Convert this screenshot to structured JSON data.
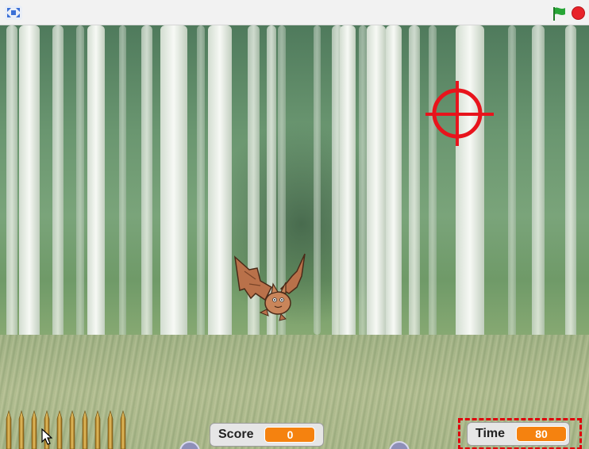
{
  "toolbar": {
    "fullscreen_icon": "fullscreen-icon",
    "green_flag_icon": "green-flag-icon",
    "stop_icon": "stop-sign-icon"
  },
  "stage": {
    "background": "forest",
    "sprites": [
      "crosshair",
      "bat",
      "bullets"
    ]
  },
  "monitors": {
    "score": {
      "label": "Score",
      "value": "0"
    },
    "time": {
      "label": "Time",
      "value": "80"
    }
  },
  "colors": {
    "monitor_value": "#f5820f",
    "crosshair": "#e8141c",
    "highlight": "#e0000b",
    "flag": "#27a536",
    "stop": "#e8232a"
  }
}
